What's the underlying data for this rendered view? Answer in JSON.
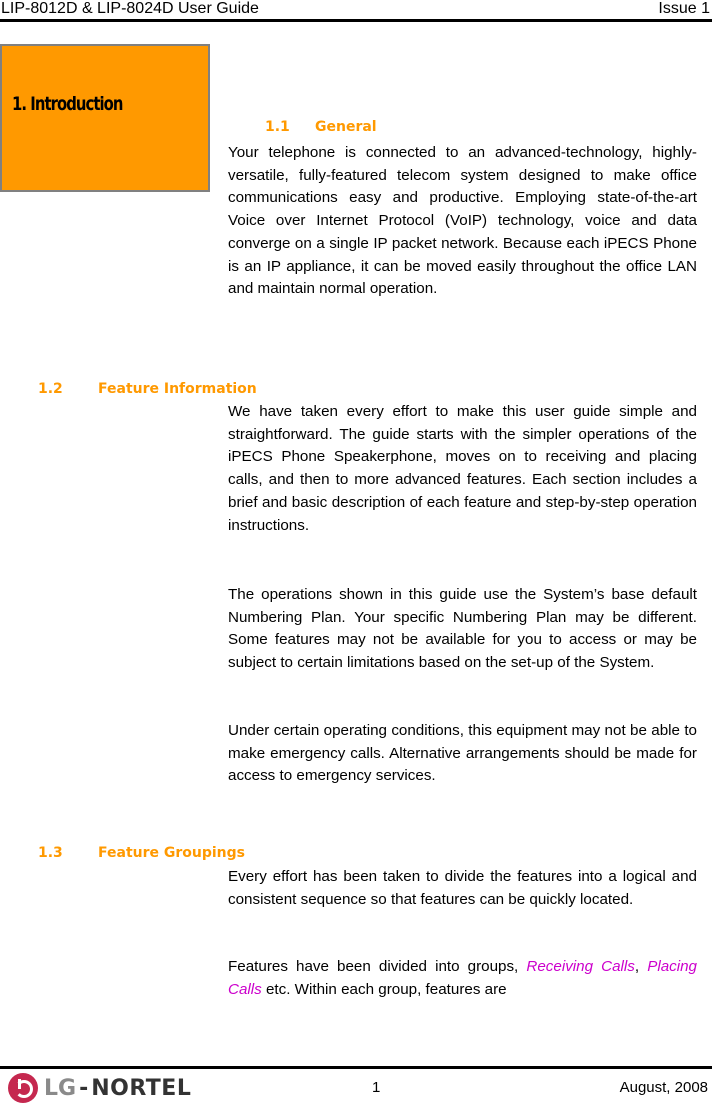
{
  "header": {
    "title": "LIP-8012D & LIP-8024D User Guide",
    "issue": "Issue 1"
  },
  "chapter": {
    "title": "1. Introduction",
    "box_color": "#ff9900"
  },
  "sections": [
    {
      "number": "1.1",
      "title": "General",
      "paragraphs": [
        "Your telephone is connected to an advanced-technology, highly-versatile, fully-featured telecom system designed to make office communications easy and productive.  Employing state-of-the-art Voice over Internet Protocol (VoIP) technology, voice and data converge on a single IP packet network.  Because each iPECS Phone is an IP appliance, it can be moved easily throughout the office LAN and maintain normal operation."
      ]
    },
    {
      "number": "1.2",
      "title": "Feature Information",
      "paragraphs": [
        "We have taken every effort to make this user guide simple and straightforward.  The guide starts with the simpler operations of the iPECS Phone Speakerphone, moves on to receiving and placing calls, and then to more advanced features.  Each section includes a brief and basic description of each feature and step-by-step operation instructions.",
        "The operations shown in this guide use the System’s base default Numbering Plan.  Your specific Numbering Plan may be different.  Some features may not be available for you to access or may be subject to certain limitations based on the set-up of the System.",
        "Under certain operating conditions, this equipment may not be able to make emergency calls. Alternative arrangements should be made for access to emergency services."
      ]
    },
    {
      "number": "1.3",
      "title": "Feature Groupings",
      "paragraphs": [
        "Every effort has been taken to divide the features into a logical and consistent sequence so that features can be quickly located."
      ],
      "groups_paragraph": {
        "before": "Features have been divided into groups, ",
        "link1": "Receiving Calls",
        "sep": ", ",
        "link2": "Placing Calls",
        "after": " etc.  Within each group, features are"
      }
    }
  ],
  "heading_color": "#ff9900",
  "link_color": "#cc00cc",
  "footer": {
    "logo_lg": "LG",
    "logo_dash": "-",
    "logo_nortel": "NORTEL",
    "page_number": "1",
    "date": "August, 2008"
  }
}
